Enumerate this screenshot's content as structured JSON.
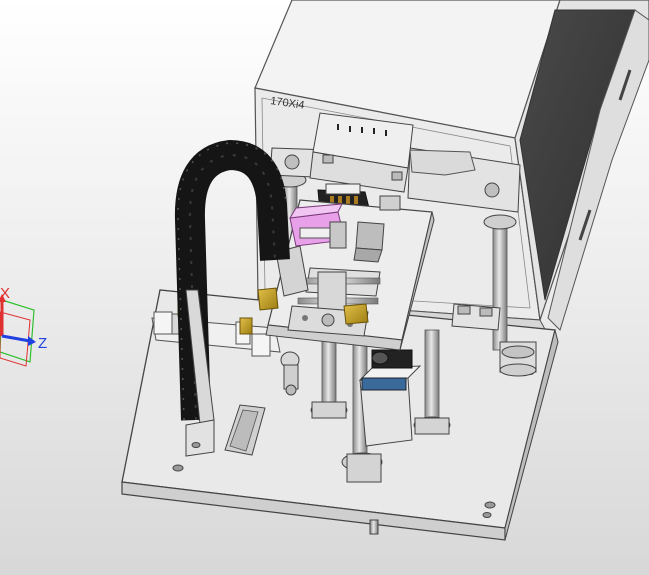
{
  "viewport": {
    "background_top": "#ffffff",
    "background_bottom": "#d8d8d8"
  },
  "printer": {
    "model_label": "170Xi4"
  },
  "triad": {
    "x_label": "X",
    "z_label": "Z",
    "x_color": "#e03030",
    "y_color": "#30c030",
    "z_color": "#2040e0"
  },
  "colors": {
    "body": "#e9e9e9",
    "edge": "#444444",
    "cable_chain": "#151515",
    "brass": "#c9a520",
    "pink": "#e8a0e8",
    "blue_block": "#3a6a9a",
    "rod": "#b8b8b8"
  }
}
